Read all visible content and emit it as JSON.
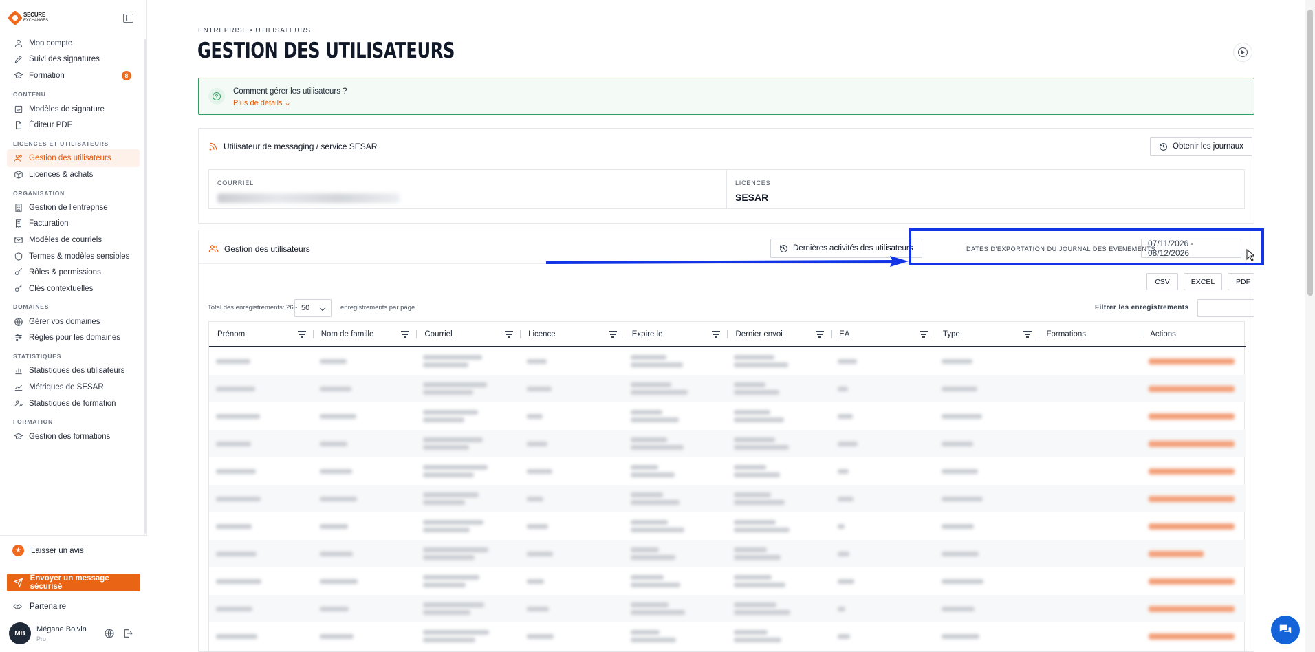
{
  "sidebar": {
    "logo_text": "SECURE EXCHANGES",
    "items": [
      {
        "label": "Mon compte",
        "icon": "user-icon"
      },
      {
        "label": "Suivi des signatures",
        "icon": "pen-icon"
      },
      {
        "label": "Formation",
        "icon": "graduation-icon",
        "badge": "8"
      },
      {
        "label": "Modèles de signature",
        "icon": "template-icon"
      },
      {
        "label": "Éditeur PDF",
        "icon": "file-icon"
      },
      {
        "label": "Gestion des utilisateurs",
        "icon": "users-icon",
        "active": true
      },
      {
        "label": "Licences & achats",
        "icon": "box-icon"
      },
      {
        "label": "Gestion de l'entreprise",
        "icon": "building-icon"
      },
      {
        "label": "Facturation",
        "icon": "invoice-icon"
      },
      {
        "label": "Modèles de courriels",
        "icon": "mail-icon"
      },
      {
        "label": "Termes & modèles sensibles",
        "icon": "shield-icon"
      },
      {
        "label": "Rôles & permissions",
        "icon": "key-icon"
      },
      {
        "label": "Clés contextuelles",
        "icon": "key-icon"
      },
      {
        "label": "Gérer vos domaines",
        "icon": "globe-icon"
      },
      {
        "label": "Règles pour les domaines",
        "icon": "sliders-icon"
      },
      {
        "label": "Statistiques des utilisateurs",
        "icon": "bar-chart-icon"
      },
      {
        "label": "Métriques de SESAR",
        "icon": "line-chart-icon"
      },
      {
        "label": "Statistiques de formation",
        "icon": "users-chart-icon"
      },
      {
        "label": "Gestion des formations",
        "icon": "graduation-icon"
      }
    ],
    "sections": [
      "CONTENU",
      "LICENCES ET UTILISATEURS",
      "ORGANISATION",
      "DOMAINES",
      "STATISTIQUES",
      "FORMATION"
    ],
    "review_label": "Laisser un avis",
    "send_label": "Envoyer un message sécurisé",
    "partner_label": "Partenaire",
    "user": {
      "initials": "MB",
      "name": "Mégane Boivin",
      "plan": "Pro"
    }
  },
  "main": {
    "breadcrumb": "ENTREPRISE • UTILISATEURS",
    "title": "GESTION DES UTILISATEURS",
    "help": {
      "title": "Comment gérer les utilisateurs ?",
      "more": "Plus de détails"
    },
    "service_card": {
      "title": "Utilisateur de messaging / service SESAR",
      "logs_button": "Obtenir les journaux",
      "email_label": "COURRIEL",
      "licence_label": "LICENCES",
      "licence_value": "SESAR"
    },
    "users_card": {
      "title": "Gestion des utilisateurs",
      "recent_button": "Dernières activités des utilisateurs",
      "export_label": "DATES D'EXPORTATION DU JOURNAL DES ÉVÉNEMENTS",
      "date_range": "07/11/2026 - 08/12/2026",
      "export_buttons": {
        "csv": "CSV",
        "excel": "EXCEL",
        "pdf": "PDF"
      },
      "total_label": "Total des enregistrements: 26 -",
      "page_size": "50",
      "per_page_label": "enregistrements par page",
      "filter_label": "Filtrer les enregistrements",
      "columns": [
        "Prénom",
        "Nom de famille",
        "Courriel",
        "Licence",
        "Expire le",
        "Dernier envoi",
        "EA",
        "Type",
        "Formations",
        "Actions"
      ],
      "filterable": [
        true,
        true,
        true,
        true,
        true,
        true,
        true,
        true,
        false,
        false
      ]
    }
  },
  "colors": {
    "accent": "#ea6415",
    "annotation": "#1234e6",
    "help_border": "#2f9e63"
  }
}
